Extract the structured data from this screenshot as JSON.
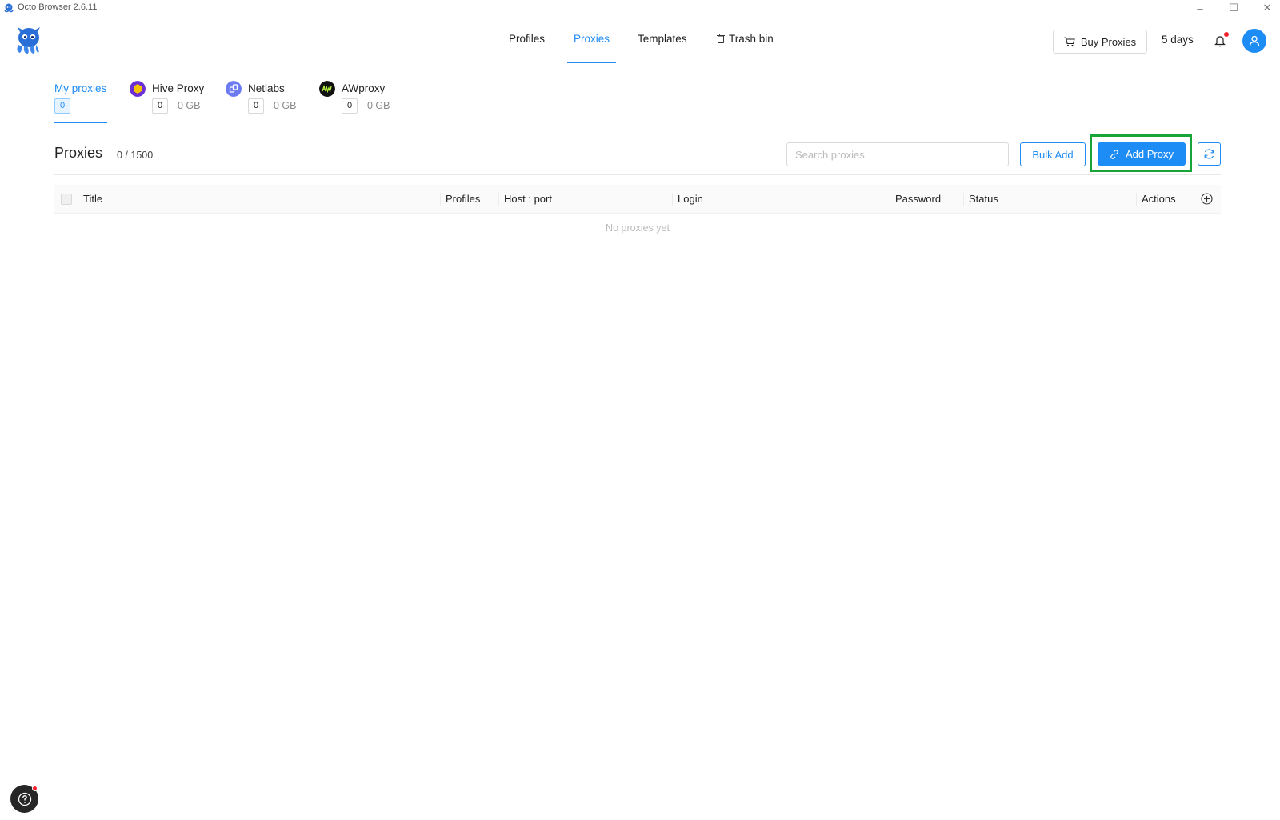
{
  "window": {
    "title": "Octo Browser 2.6.11",
    "controls": {
      "minimize": "–",
      "maximize": "☐",
      "close": "✕"
    }
  },
  "header": {
    "nav": [
      {
        "label": "Profiles",
        "active": false
      },
      {
        "label": "Proxies",
        "active": true
      },
      {
        "label": "Templates",
        "active": false
      },
      {
        "label": "Trash bin",
        "active": false,
        "icon": "trash-icon"
      }
    ],
    "buy_proxies_label": "Buy Proxies",
    "subscription_days": "5 days"
  },
  "provider_tabs": [
    {
      "label": "My proxies",
      "count": "0",
      "active": true
    },
    {
      "label": "Hive Proxy",
      "count": "0",
      "traffic": "0 GB",
      "icon": "hive-proxy-icon",
      "color": "#6b2fd6"
    },
    {
      "label": "Netlabs",
      "count": "0",
      "traffic": "0 GB",
      "icon": "netlabs-icon",
      "color": "#6d7bf2"
    },
    {
      "label": "AWproxy",
      "count": "0",
      "traffic": "0 GB",
      "icon": "awproxy-icon",
      "color": "#111111"
    }
  ],
  "proxies": {
    "title": "Proxies",
    "count": "0 / 1500",
    "search_placeholder": "Search proxies",
    "bulk_add_label": "Bulk Add",
    "add_proxy_label": "Add Proxy"
  },
  "table": {
    "columns": [
      "Title",
      "Profiles",
      "Host : port",
      "Login",
      "Password",
      "Status",
      "Actions"
    ],
    "empty_text": "No proxies yet"
  },
  "colors": {
    "accent": "#1e8cf5",
    "highlight": "#19a43a",
    "notification": "#f5222d"
  }
}
